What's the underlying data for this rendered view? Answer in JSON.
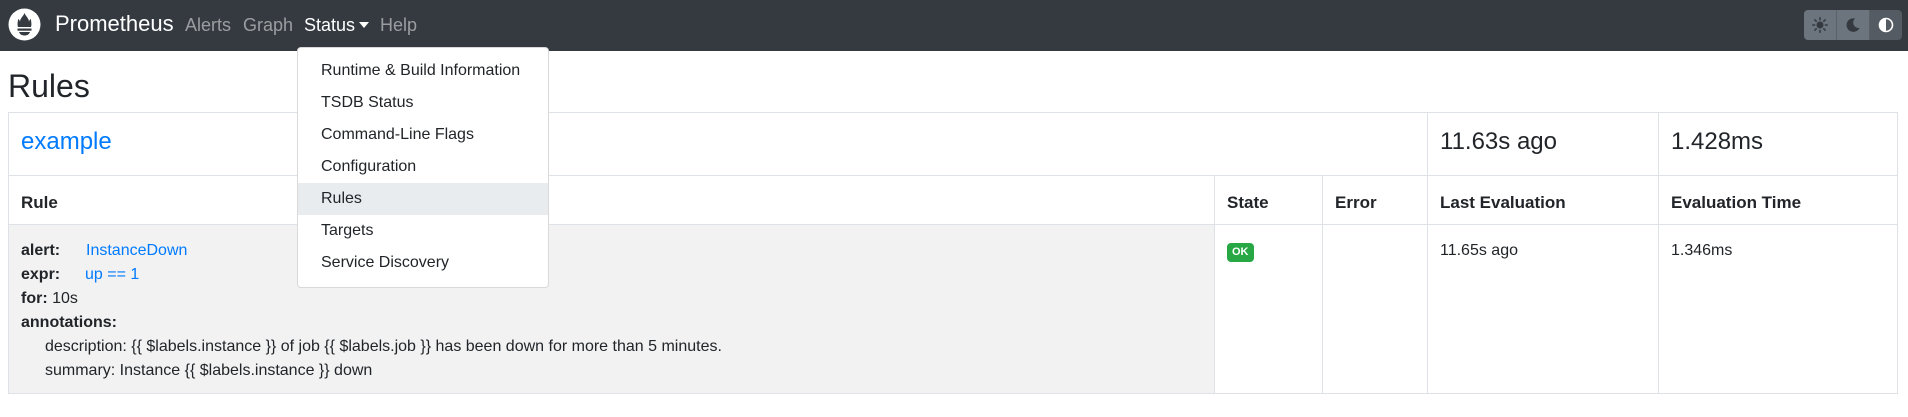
{
  "navbar": {
    "brand": "Prometheus",
    "links": {
      "alerts": "Alerts",
      "graph": "Graph",
      "status": "Status",
      "help": "Help"
    },
    "theme_icons": [
      "sun-icon",
      "moon-icon",
      "half-circle-icon"
    ]
  },
  "status_menu": {
    "items": [
      "Runtime & Build Information",
      "TSDB Status",
      "Command-Line Flags",
      "Configuration",
      "Rules",
      "Targets",
      "Service Discovery"
    ],
    "active": "Rules"
  },
  "page": {
    "title": "Rules"
  },
  "group": {
    "name": "example",
    "last_evaluation": "11.63s ago",
    "evaluation_time": "1.428ms"
  },
  "table": {
    "headers": {
      "rule": "Rule",
      "state": "State",
      "error": "Error",
      "last_evaluation": "Last Evaluation",
      "evaluation_time": "Evaluation Time"
    },
    "rule": {
      "alert_key": "alert:",
      "alert_value": "InstanceDown",
      "expr_key": "expr:",
      "expr_value": "up == 1",
      "for_key": "for:",
      "for_value": "10s",
      "annotations_key": "annotations:",
      "annotations": [
        "description: {{ $labels.instance }} of job {{ $labels.job }} has been down for more than 5 minutes.",
        "summary: Instance {{ $labels.instance }} down"
      ],
      "state": "OK",
      "error": "",
      "last_evaluation": "11.65s ago",
      "evaluation_time": "1.346ms"
    }
  },
  "colors": {
    "navbar": "#343a40",
    "link": "#007bff",
    "ok_badge": "#28a745",
    "row_background": "#f2f2f2"
  }
}
